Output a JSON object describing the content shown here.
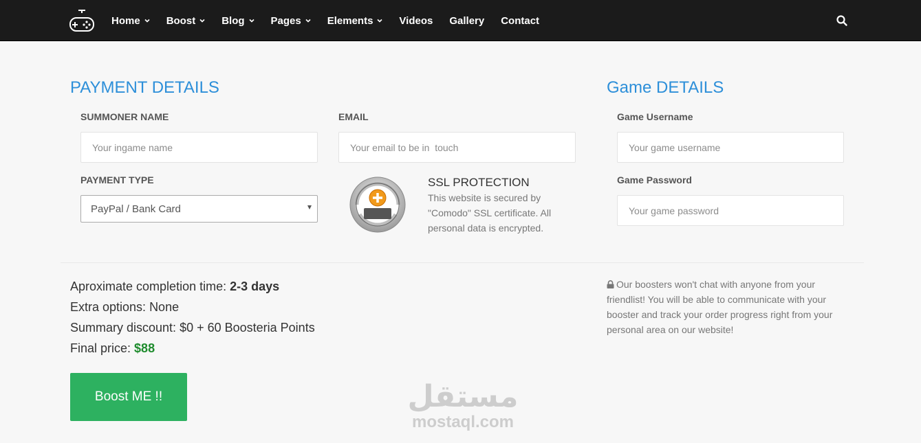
{
  "nav": {
    "items": [
      {
        "label": "Home",
        "dropdown": true
      },
      {
        "label": "Boost",
        "dropdown": true
      },
      {
        "label": "Blog",
        "dropdown": true
      },
      {
        "label": "Pages",
        "dropdown": true
      },
      {
        "label": "Elements",
        "dropdown": true
      },
      {
        "label": "Videos",
        "dropdown": false
      },
      {
        "label": "Gallery",
        "dropdown": false
      },
      {
        "label": "Contact",
        "dropdown": false
      }
    ],
    "logo_icon": "gamepad-icon",
    "search_icon": "search-icon"
  },
  "payment": {
    "title": "PAYMENT DETAILS",
    "summoner_label": "SUMMONER NAME",
    "summoner_placeholder": "Your ingame name",
    "email_label": "EMAIL",
    "email_placeholder": "Your email to be in  touch",
    "payment_type_label": "PAYMENT TYPE",
    "payment_type_value": "PayPal / Bank Card",
    "ssl_title": "SSL PROTECTION",
    "ssl_text": "This website is secured by \"Comodo\" SSL certificate. All personal data is encrypted."
  },
  "game": {
    "title": "Game DETAILS",
    "username_label": "Game Username",
    "username_placeholder": "Your game username",
    "password_label": "Game Password",
    "password_placeholder": "Your game password"
  },
  "summary": {
    "completion_label": "Aproximate completion time: ",
    "completion_value": "2-3 days",
    "extra_label": "Extra options: ",
    "extra_value": "None",
    "discount_label": "Summary discount: ",
    "discount_value": "$0 + 60 Boosteria Points",
    "final_label": "Final price: ",
    "final_value": "$88",
    "button_label": "Boost ME !!"
  },
  "notice": {
    "text": "Our boosters won't chat with anyone from your friendlist! You will be able to communicate with your booster and track your order progress right from your personal area on our website!"
  },
  "watermark": {
    "arabic": "مستقل",
    "latin": "mostaql.com"
  },
  "colors": {
    "accent": "#2d8fd9",
    "button": "#2db160",
    "price": "#1f8c2e",
    "navbar": "#1b1b1b"
  }
}
